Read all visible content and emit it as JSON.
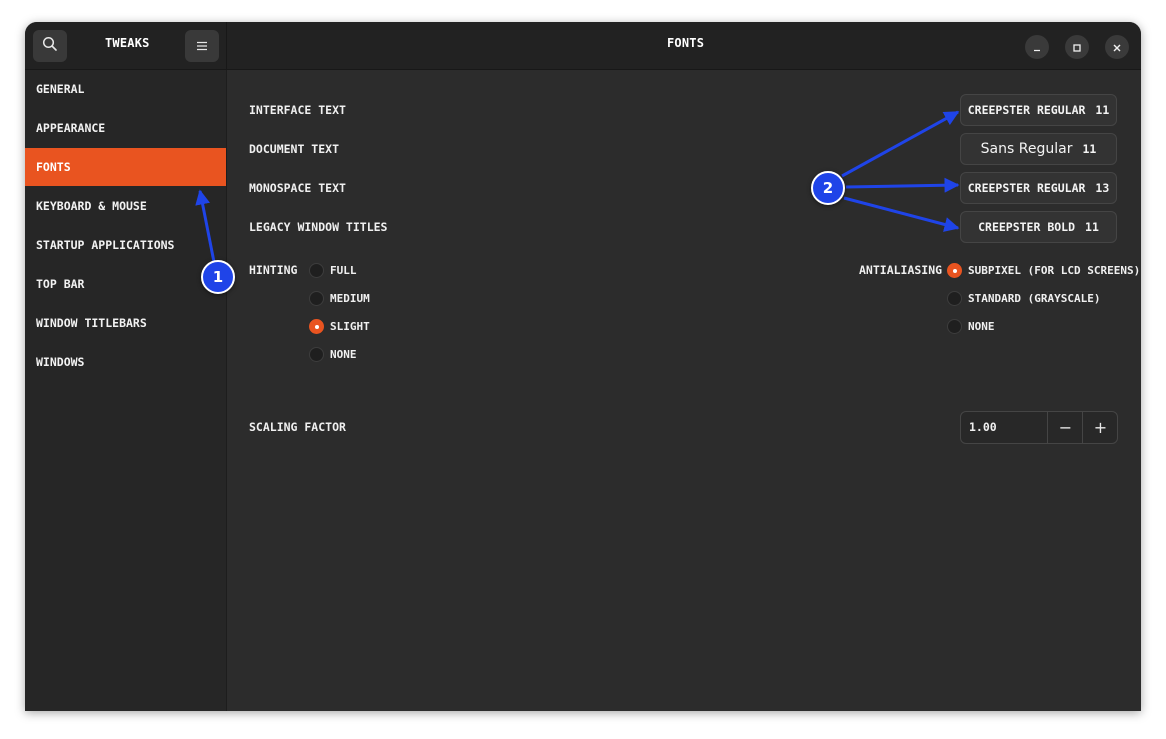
{
  "header": {
    "sidebar_title": "TWEAKS",
    "page_title": "FONTS",
    "search_icon": "search-icon",
    "menu_icon": "hamburger-menu-icon"
  },
  "sidebar": {
    "items": [
      {
        "label": "GENERAL"
      },
      {
        "label": "APPEARANCE"
      },
      {
        "label": "FONTS",
        "active": true
      },
      {
        "label": "KEYBOARD & MOUSE"
      },
      {
        "label": "STARTUP APPLICATIONS"
      },
      {
        "label": "TOP BAR"
      },
      {
        "label": "WINDOW TITLEBARS"
      },
      {
        "label": "WINDOWS"
      }
    ]
  },
  "fonts": {
    "rows": [
      {
        "label": "INTERFACE TEXT",
        "font": "CREEPSTER REGULAR",
        "size": "11"
      },
      {
        "label": "DOCUMENT TEXT",
        "font": "Sans Regular",
        "size": "11"
      },
      {
        "label": "MONOSPACE TEXT",
        "font": "CREEPSTER REGULAR",
        "size": "13"
      },
      {
        "label": "LEGACY WINDOW TITLES",
        "font": "CREEPSTER BOLD",
        "size": "11"
      }
    ]
  },
  "hinting": {
    "label": "HINTING",
    "options": [
      "FULL",
      "MEDIUM",
      "SLIGHT",
      "NONE"
    ],
    "selected": "SLIGHT"
  },
  "antialiasing": {
    "label": "ANTIALIASING",
    "options": [
      "SUBPIXEL (FOR LCD SCREENS)",
      "STANDARD (GRAYSCALE)",
      "NONE"
    ],
    "selected": "SUBPIXEL (FOR LCD SCREENS)"
  },
  "scaling": {
    "label": "SCALING FACTOR",
    "value": "1.00",
    "minus": "−",
    "plus": "+"
  },
  "annotations": {
    "badge1": "1",
    "badge2": "2",
    "color": "#1f44e8"
  },
  "colors": {
    "accent": "#e95420",
    "bg": "#2c2c2c",
    "sidebar_bg": "#262626"
  }
}
